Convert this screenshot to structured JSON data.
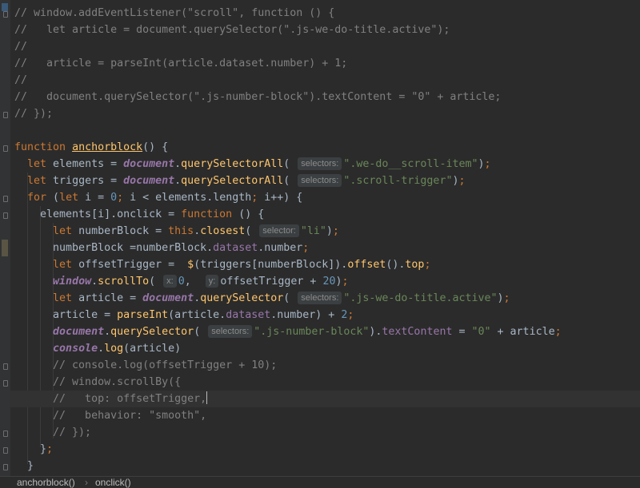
{
  "colors": {
    "keyword": "#cc7832",
    "function": "#ffc66d",
    "string": "#6a8759",
    "number": "#6897bb",
    "global": "#9876aa",
    "comment": "#808080",
    "text": "#a9b7c6",
    "background": "#2b2b2b"
  },
  "editor": {
    "current_line": 23,
    "lines": [
      [
        {
          "t": "// window.addEventListener(\"scroll\", function () {",
          "c": "comment"
        }
      ],
      [
        {
          "t": "//   let article = document.querySelector(\".js-we-do-title.active\");",
          "c": "comment"
        }
      ],
      [
        {
          "t": "//",
          "c": "comment"
        }
      ],
      [
        {
          "t": "//   article = parseInt(article.dataset.number) + 1;",
          "c": "comment"
        }
      ],
      [
        {
          "t": "//",
          "c": "comment"
        }
      ],
      [
        {
          "t": "//   document.querySelector(\".js-number-block\").textContent = \"0\" + article;",
          "c": "comment"
        }
      ],
      [
        {
          "t": "// });",
          "c": "comment"
        }
      ],
      [],
      [
        {
          "t": "function ",
          "c": "kw"
        },
        {
          "t": "anchorblock",
          "c": "fnu"
        },
        {
          "t": "() {"
        }
      ],
      [
        {
          "t": "  "
        },
        {
          "t": "let ",
          "c": "kw"
        },
        {
          "t": "elements = "
        },
        {
          "t": "document",
          "c": "glob"
        },
        {
          "t": "."
        },
        {
          "t": "querySelectorAll",
          "c": "fn"
        },
        {
          "t": "( "
        },
        {
          "h": "selectors:"
        },
        {
          "t": "\".we-do__scroll-item\"",
          "c": "str"
        },
        {
          "t": ")"
        },
        {
          "t": ";",
          "c": "kw"
        }
      ],
      [
        {
          "t": "  "
        },
        {
          "t": "let ",
          "c": "kw"
        },
        {
          "t": "triggers = "
        },
        {
          "t": "document",
          "c": "glob"
        },
        {
          "t": "."
        },
        {
          "t": "querySelectorAll",
          "c": "fn"
        },
        {
          "t": "( "
        },
        {
          "h": "selectors:"
        },
        {
          "t": "\".scroll-trigger\"",
          "c": "str"
        },
        {
          "t": ")"
        },
        {
          "t": ";",
          "c": "kw"
        }
      ],
      [
        {
          "t": "  "
        },
        {
          "t": "for ",
          "c": "kw"
        },
        {
          "t": "("
        },
        {
          "t": "let ",
          "c": "kw"
        },
        {
          "t": "i = "
        },
        {
          "t": "0",
          "c": "num"
        },
        {
          "t": "; ",
          "c": "kw"
        },
        {
          "t": "i < elements.length"
        },
        {
          "t": "; ",
          "c": "kw"
        },
        {
          "t": "i++) {"
        }
      ],
      [
        {
          "t": "    elements[i].onclick = "
        },
        {
          "t": "function ",
          "c": "kw"
        },
        {
          "t": "() {"
        }
      ],
      [
        {
          "t": "      "
        },
        {
          "t": "let ",
          "c": "kw"
        },
        {
          "t": "numberBlock = "
        },
        {
          "t": "this",
          "c": "kw"
        },
        {
          "t": "."
        },
        {
          "t": "closest",
          "c": "fn"
        },
        {
          "t": "( "
        },
        {
          "h": "selector:"
        },
        {
          "t": "\"li\"",
          "c": "str"
        },
        {
          "t": ")"
        },
        {
          "t": ";",
          "c": "kw"
        }
      ],
      [
        {
          "t": "      numberBlock =numberBlock."
        },
        {
          "t": "dataset",
          "c": "glob2"
        },
        {
          "t": ".number"
        },
        {
          "t": ";",
          "c": "kw"
        }
      ],
      [
        {
          "t": "      "
        },
        {
          "t": "let ",
          "c": "kw"
        },
        {
          "t": "offsetTrigger =  "
        },
        {
          "t": "$",
          "c": "fn"
        },
        {
          "t": "(triggers[numberBlock])."
        },
        {
          "t": "offset",
          "c": "fn"
        },
        {
          "t": "()."
        },
        {
          "t": "top",
          "c": "fn"
        },
        {
          "t": ";",
          "c": "kw"
        }
      ],
      [
        {
          "t": "      "
        },
        {
          "t": "window",
          "c": "glob"
        },
        {
          "t": "."
        },
        {
          "t": "scrollTo",
          "c": "fn"
        },
        {
          "t": "( "
        },
        {
          "h": "x:"
        },
        {
          "t": "0",
          "c": "num"
        },
        {
          "t": ",  "
        },
        {
          "h": "y:"
        },
        {
          "t": "offsetTrigger + "
        },
        {
          "t": "20",
          "c": "num"
        },
        {
          "t": ")"
        },
        {
          "t": ";",
          "c": "kw"
        }
      ],
      [
        {
          "t": "      "
        },
        {
          "t": "let ",
          "c": "kw"
        },
        {
          "t": "article = "
        },
        {
          "t": "document",
          "c": "glob"
        },
        {
          "t": "."
        },
        {
          "t": "querySelector",
          "c": "fn"
        },
        {
          "t": "( "
        },
        {
          "h": "selectors:"
        },
        {
          "t": "\".js-we-do-title.active\"",
          "c": "str"
        },
        {
          "t": ")"
        },
        {
          "t": ";",
          "c": "kw"
        }
      ],
      [
        {
          "t": "      article = "
        },
        {
          "t": "parseInt",
          "c": "fn"
        },
        {
          "t": "(article."
        },
        {
          "t": "dataset",
          "c": "glob2"
        },
        {
          "t": ".number) + "
        },
        {
          "t": "2",
          "c": "num"
        },
        {
          "t": ";",
          "c": "kw"
        }
      ],
      [
        {
          "t": "      "
        },
        {
          "t": "document",
          "c": "glob"
        },
        {
          "t": "."
        },
        {
          "t": "querySelector",
          "c": "fn"
        },
        {
          "t": "( "
        },
        {
          "h": "selectors:"
        },
        {
          "t": "\".js-number-block\"",
          "c": "str"
        },
        {
          "t": ")."
        },
        {
          "t": "textContent",
          "c": "glob2"
        },
        {
          "t": " = "
        },
        {
          "t": "\"0\"",
          "c": "str"
        },
        {
          "t": " + article"
        },
        {
          "t": ";",
          "c": "kw"
        }
      ],
      [
        {
          "t": "      "
        },
        {
          "t": "console",
          "c": "glob"
        },
        {
          "t": "."
        },
        {
          "t": "log",
          "c": "fn"
        },
        {
          "t": "(article)"
        }
      ],
      [
        {
          "t": "      // console.log(offsetTrigger + 10);",
          "c": "comment"
        }
      ],
      [
        {
          "t": "      // window.scrollBy({",
          "c": "comment"
        }
      ],
      [
        {
          "t": "      //   top: offsetTrigger,",
          "c": "comment"
        },
        {
          "caret": true
        }
      ],
      [
        {
          "t": "      //   behavior: \"smooth\",",
          "c": "comment"
        }
      ],
      [
        {
          "t": "      // });",
          "c": "comment"
        }
      ],
      [
        {
          "t": "    }"
        },
        {
          "t": ";",
          "c": "kw"
        }
      ],
      [
        {
          "t": "  }"
        }
      ]
    ]
  },
  "breadcrumbs": {
    "first": "anchorblock()",
    "separator": "›",
    "second": "onclick()"
  }
}
